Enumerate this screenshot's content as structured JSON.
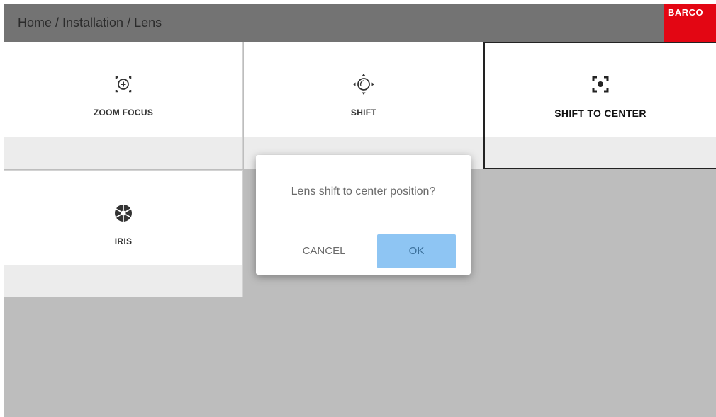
{
  "header": {
    "breadcrumb": "Home / Installation / Lens",
    "brand": "BARCO",
    "brand_color": "#e30613"
  },
  "tiles": [
    {
      "label": "ZOOM FOCUS",
      "icon": "zoom-focus-icon",
      "selected": false
    },
    {
      "label": "SHIFT",
      "icon": "shift-icon",
      "selected": false
    },
    {
      "label": "SHIFT TO CENTER",
      "icon": "shift-to-center-icon",
      "selected": true
    },
    {
      "label": "IRIS",
      "icon": "iris-icon",
      "selected": false
    }
  ],
  "dialog": {
    "message": "Lens shift to center position?",
    "cancel_label": "CANCEL",
    "ok_label": "OK",
    "ok_color": "#8ec5f3"
  }
}
